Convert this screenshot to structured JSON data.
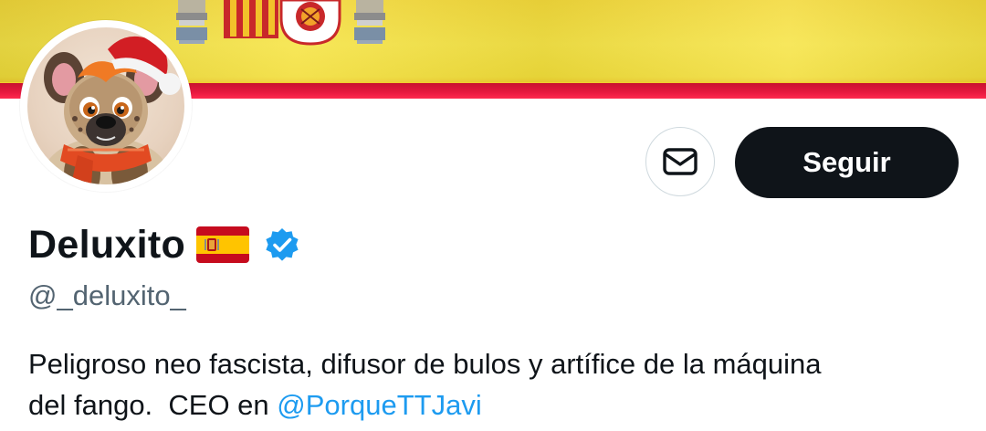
{
  "banner": {
    "description_icon": "spain-flag-banner",
    "colors": {
      "yellow": "#f3dd3a",
      "red": "#e0143f"
    }
  },
  "avatar": {
    "icon": "hyena-santa-hat-avatar"
  },
  "actions": {
    "message_icon": "envelope-icon",
    "follow_label": "Seguir"
  },
  "profile": {
    "display_name": "Deluxito",
    "name_emoji_icon": "spain-flag-emoji-icon",
    "verified_icon": "verified-badge-icon",
    "handle": "@_deluxito_",
    "bio_text_line1": "Peligroso neo fascista, difusor de bulos y artífice de la máquina",
    "bio_text_line2": "del fango.  CEO en ",
    "bio_mention": "@PorqueTTJavi"
  },
  "colors": {
    "text": "#0f1419",
    "secondary": "#536471",
    "link": "#1d9bf0",
    "button_dark": "#0f1419",
    "verified": "#1d9bf0"
  }
}
